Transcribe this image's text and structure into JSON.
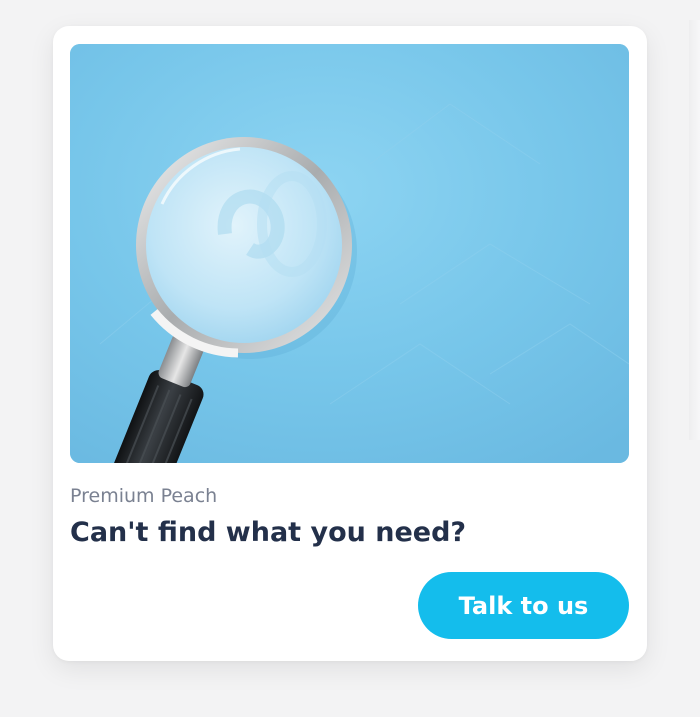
{
  "card": {
    "brand": "Premium Peach",
    "headline": "Can't find what you need?",
    "cta_label": "Talk to us"
  },
  "hero_image": {
    "icon": "magnifying-glass-icon",
    "colors": {
      "background": "#79c9ec",
      "lens": "#d6eef9",
      "handle": "#1f2326"
    }
  },
  "colors": {
    "accent": "#14bdec",
    "headline": "#23304a",
    "brand": "#7a8191",
    "page": "#f3f3f4",
    "card": "#ffffff"
  }
}
